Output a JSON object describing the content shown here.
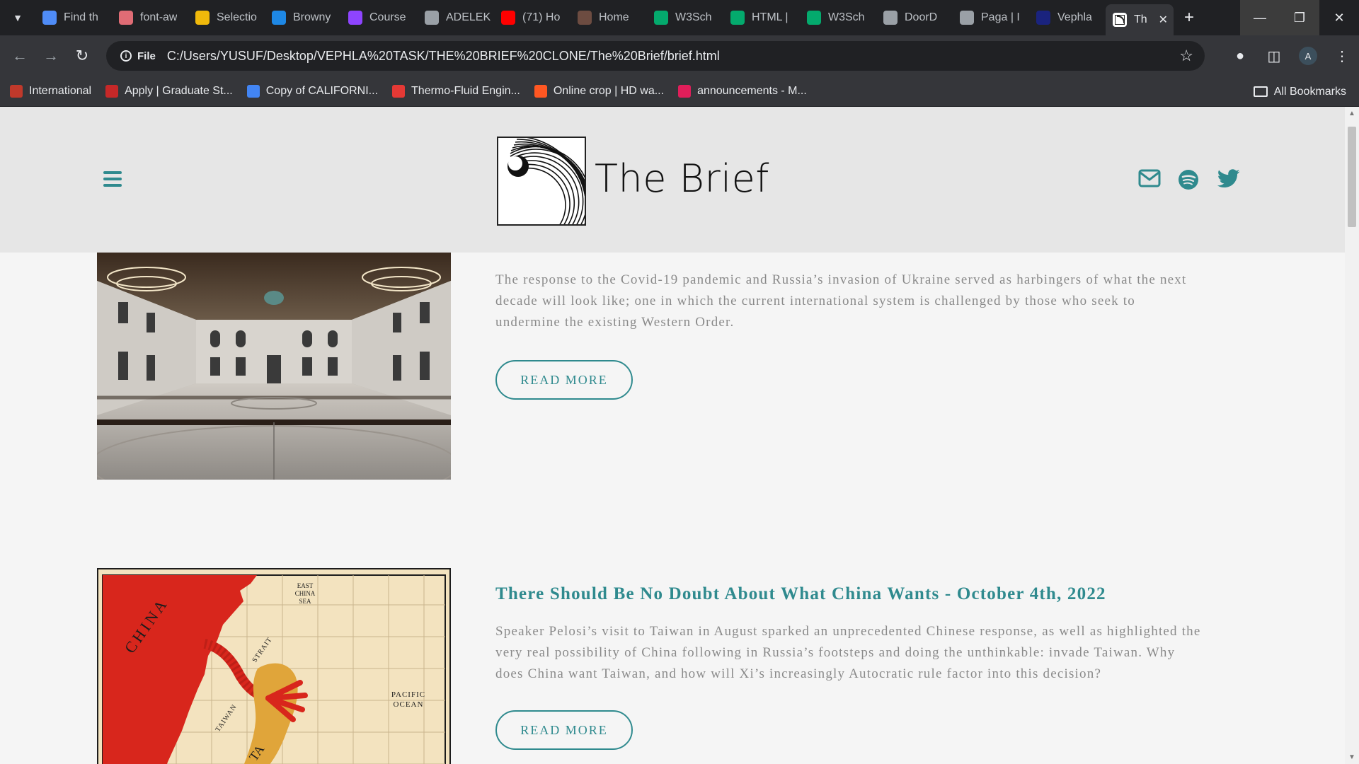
{
  "browser": {
    "tabs": [
      {
        "title": "Find th",
        "icon": "flag-icon",
        "color": "#4f8cf7"
      },
      {
        "title": "font-aw",
        "icon": "code-icon",
        "color": "#e06c75"
      },
      {
        "title": "Selectio",
        "icon": "zoho-icon",
        "color": "#f0b90b"
      },
      {
        "title": "Browny",
        "icon": "browny-icon",
        "color": "#1e88e5"
      },
      {
        "title": "Course",
        "icon": "course-icon",
        "color": "#8e44ff"
      },
      {
        "title": "ADELEK",
        "icon": "globe-icon",
        "color": "#9aa0a6"
      },
      {
        "title": "(71) Ho",
        "icon": "youtube-icon",
        "color": "#ff0000"
      },
      {
        "title": "Home",
        "icon": "profile-icon",
        "color": "#6d4c41"
      },
      {
        "title": "W3Sch",
        "icon": "w3schools-icon",
        "color": "#04aa6d"
      },
      {
        "title": "HTML |",
        "icon": "w3schools-icon",
        "color": "#04aa6d"
      },
      {
        "title": "W3Sch",
        "icon": "w3schools-icon",
        "color": "#04aa6d"
      },
      {
        "title": "DoorD",
        "icon": "globe-icon",
        "color": "#9aa0a6"
      },
      {
        "title": "Paga | I",
        "icon": "globe-icon",
        "color": "#9aa0a6"
      },
      {
        "title": "Vephla",
        "icon": "vephla-icon",
        "color": "#1a237e"
      }
    ],
    "active_tab": {
      "title": "Th",
      "icon": "the-brief-icon"
    },
    "url_chip": "File",
    "url": "C:/Users/YUSUF/Desktop/VEPHLA%20TASK/THE%20BRIEF%20CLONE/The%20Brief/brief.html",
    "profile_initial": "A",
    "bookmarks": [
      {
        "label": "International",
        "color": "#c0392b"
      },
      {
        "label": "Apply | Graduate St...",
        "color": "#c62828"
      },
      {
        "label": "Copy of CALIFORNI...",
        "color": "#4285f4"
      },
      {
        "label": "Thermo-Fluid Engin...",
        "color": "#e53935"
      },
      {
        "label": "Online crop | HD wa...",
        "color": "#ff5722"
      },
      {
        "label": "announcements - M...",
        "color": "#e01e5a"
      }
    ],
    "all_bookmarks": "All Bookmarks"
  },
  "site": {
    "brand": "The Brief",
    "accent": "#2f8a8e",
    "social": [
      "mail-icon",
      "spotify-icon",
      "twitter-icon"
    ]
  },
  "articles": [
    {
      "title": "",
      "excerpt": "The response to the Covid-19 pandemic and Russia’s invasion of Ukraine served as harbingers of what the next decade will look like; one in which the current international system is challenged by those who seek to undermine the existing Western Order.",
      "button": "READ MORE"
    },
    {
      "title": "There Should Be No Doubt About What China Wants - October 4th, 2022",
      "excerpt": "Speaker Pelosi’s visit to Taiwan in August sparked an unprecedented Chinese response, as well as highlighted the very real possibility of China following in Russia’s footsteps and doing the unthinkable: invade Taiwan. Why does China want Taiwan, and how will Xi’s increasingly Autocratic rule factor into this decision?",
      "button": "READ MORE",
      "map_labels": {
        "china": "CHINA",
        "east_china_sea": [
          "EAST",
          "CHINA",
          "SEA"
        ],
        "strait": "STRAIT",
        "taiwan": "TAIWAN",
        "pacific_ocean": [
          "PACIFIC",
          "OCEAN"
        ],
        "ta": "TA"
      }
    }
  ]
}
